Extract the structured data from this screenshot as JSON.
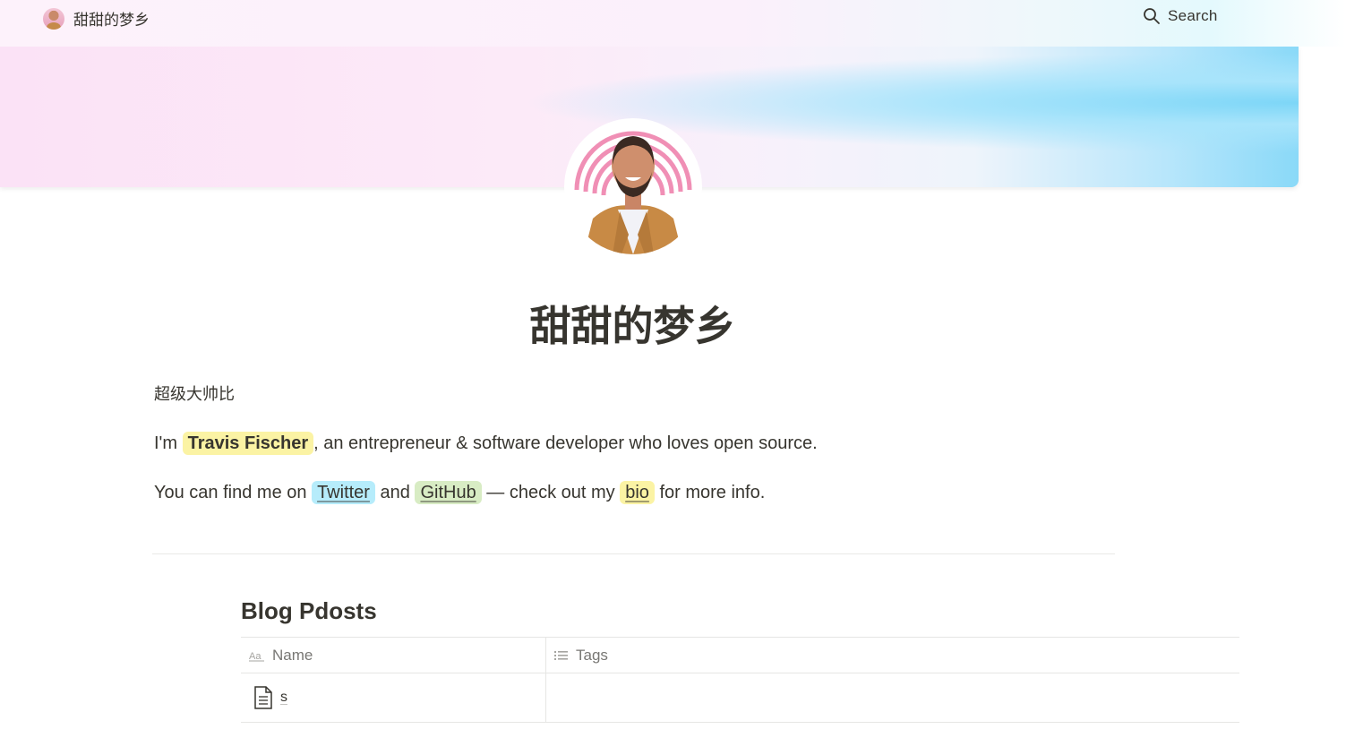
{
  "header": {
    "site_title": "甜甜的梦乡",
    "search_label": "Search"
  },
  "page": {
    "title": "甜甜的梦乡",
    "subtitle": "超级大帅比",
    "intro": {
      "prefix": "I'm ",
      "name": "Travis Fischer",
      "suffix": ", an entrepreneur & software developer who loves open source."
    },
    "links_line": {
      "prefix": "You can find me on ",
      "twitter": "Twitter",
      "and": " and ",
      "github": "GitHub",
      "middle": " — check out my ",
      "bio": "bio",
      "suffix": " for more info."
    }
  },
  "database": {
    "title": "Blog Pdosts",
    "columns": [
      {
        "label": "Name",
        "icon": "text-property-icon"
      },
      {
        "label": "Tags",
        "icon": "list-property-icon"
      }
    ],
    "rows": [
      {
        "name": "s",
        "tags": ""
      }
    ]
  },
  "colors": {
    "text": "#37352f",
    "highlight_yellow": "#fbf3a4",
    "highlight_blue": "#b6ecfb",
    "highlight_green": "#d8ecc4"
  }
}
